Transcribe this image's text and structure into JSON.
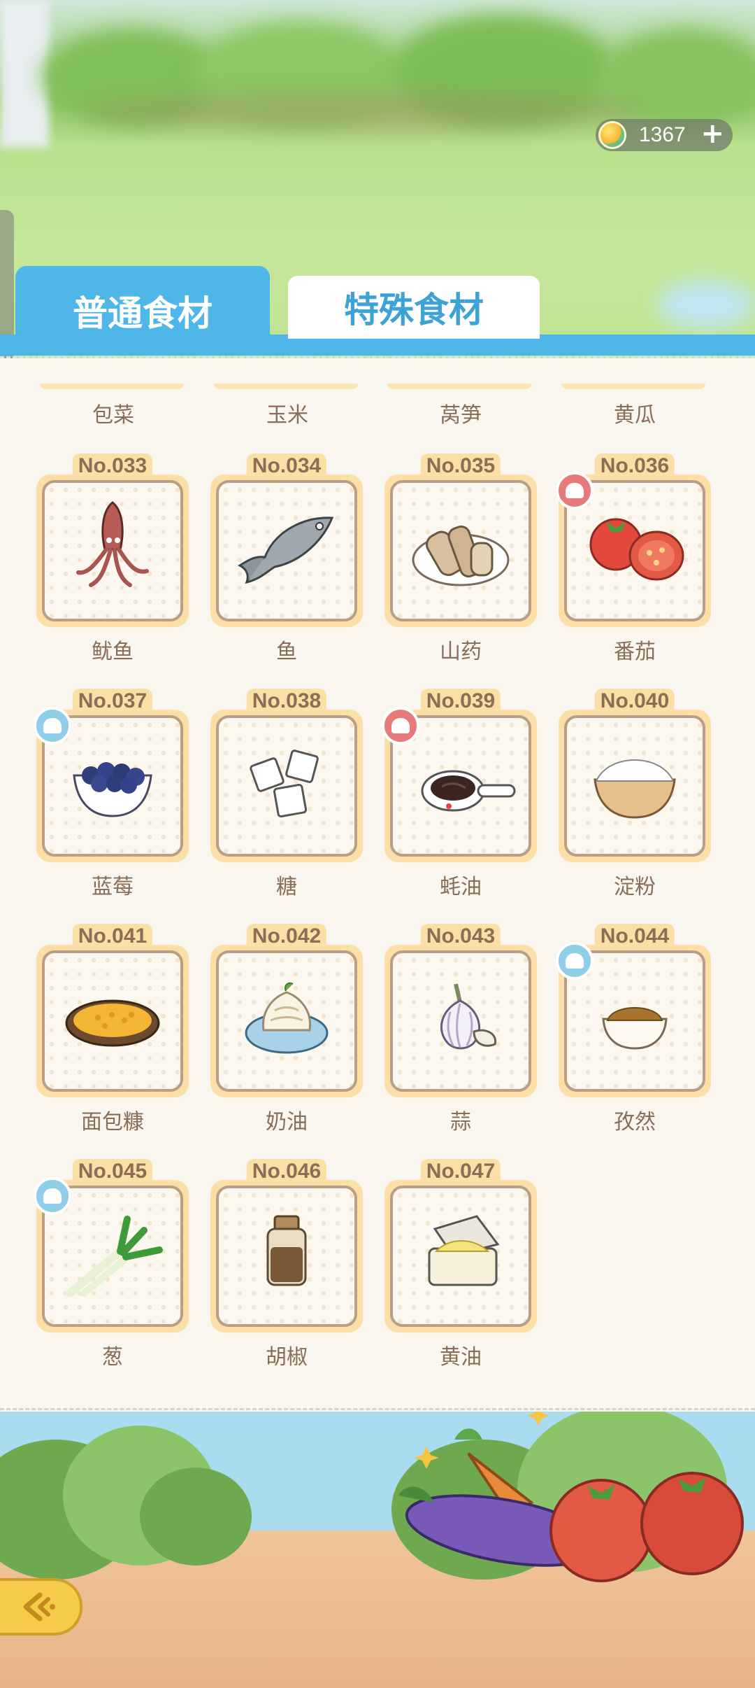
{
  "currency": {
    "amount": "1367",
    "icon": "coin-icon",
    "add_icon": "plus-icon"
  },
  "tabs": [
    {
      "label": "普通食材",
      "active": true
    },
    {
      "label": "特殊食材",
      "active": false
    }
  ],
  "partial_row": [
    "包菜",
    "玉米",
    "莴笋",
    "黄瓜"
  ],
  "items": [
    {
      "no": "No.033",
      "name": "鱿鱼",
      "badge": null,
      "icon": "squid-icon"
    },
    {
      "no": "No.034",
      "name": "鱼",
      "badge": null,
      "icon": "fish-icon"
    },
    {
      "no": "No.035",
      "name": "山药",
      "badge": null,
      "icon": "yam-icon"
    },
    {
      "no": "No.036",
      "name": "番茄",
      "badge": "red",
      "icon": "tomato-icon"
    },
    {
      "no": "No.037",
      "name": "蓝莓",
      "badge": "blue",
      "icon": "blueberry-icon"
    },
    {
      "no": "No.038",
      "name": "糖",
      "badge": null,
      "icon": "sugar-icon"
    },
    {
      "no": "No.039",
      "name": "蚝油",
      "badge": "red",
      "icon": "oyster-sauce-icon"
    },
    {
      "no": "No.040",
      "name": "淀粉",
      "badge": null,
      "icon": "starch-icon"
    },
    {
      "no": "No.041",
      "name": "面包糠",
      "badge": null,
      "icon": "breadcrumbs-icon"
    },
    {
      "no": "No.042",
      "name": "奶油",
      "badge": null,
      "icon": "cream-icon"
    },
    {
      "no": "No.043",
      "name": "蒜",
      "badge": null,
      "icon": "garlic-icon"
    },
    {
      "no": "No.044",
      "name": "孜然",
      "badge": "blue",
      "icon": "cumin-icon"
    },
    {
      "no": "No.045",
      "name": "葱",
      "badge": "blue",
      "icon": "scallion-icon"
    },
    {
      "no": "No.046",
      "name": "胡椒",
      "badge": null,
      "icon": "pepper-icon"
    },
    {
      "no": "No.047",
      "name": "黄油",
      "badge": null,
      "icon": "butter-icon"
    }
  ],
  "back_button": {
    "icon": "back-arrow-icon"
  }
}
